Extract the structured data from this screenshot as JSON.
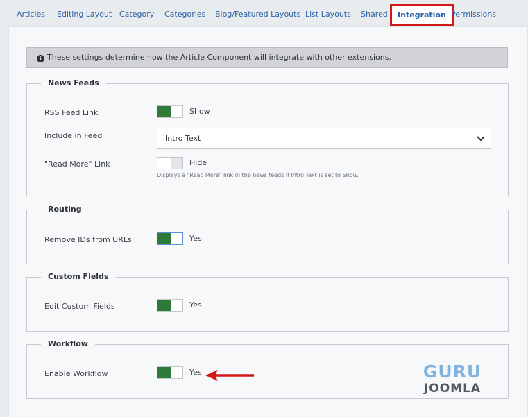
{
  "tabs": [
    {
      "label": "Articles"
    },
    {
      "label": "Editing Layout"
    },
    {
      "label": "Category"
    },
    {
      "label": "Categories"
    },
    {
      "label": "Blog/Featured Layouts"
    },
    {
      "label": "List Layouts"
    },
    {
      "label": "Shared"
    },
    {
      "label": "Integration",
      "active": true
    },
    {
      "label": "Permissions"
    }
  ],
  "alert": {
    "text": "These settings determine how the Article Component will integrate with other extensions."
  },
  "news_feeds": {
    "legend": "News Feeds",
    "rss_feed_link": {
      "label": "RSS Feed Link",
      "state": "Show",
      "on": true
    },
    "include_in_feed": {
      "label": "Include in Feed",
      "value": "Intro Text"
    },
    "read_more_link": {
      "label": "\"Read More\" Link",
      "state": "Hide",
      "on": false,
      "help": "Displays a \"Read More\" link in the news feeds if Intro Text is set to Show."
    }
  },
  "routing": {
    "legend": "Routing",
    "remove_ids": {
      "label": "Remove IDs from URLs",
      "state": "Yes",
      "on": true
    }
  },
  "custom_fields": {
    "legend": "Custom Fields",
    "edit_custom_fields": {
      "label": "Edit Custom Fields",
      "state": "Yes",
      "on": true
    }
  },
  "workflow": {
    "legend": "Workflow",
    "enable_workflow": {
      "label": "Enable Workflow",
      "state": "Yes",
      "on": true
    }
  },
  "logo": {
    "line1": "GURU",
    "line2": "JOOMLA"
  },
  "colors": {
    "accent": "#2f64a8",
    "toggle_on": "#2f7a38",
    "highlight": "#d21717"
  }
}
